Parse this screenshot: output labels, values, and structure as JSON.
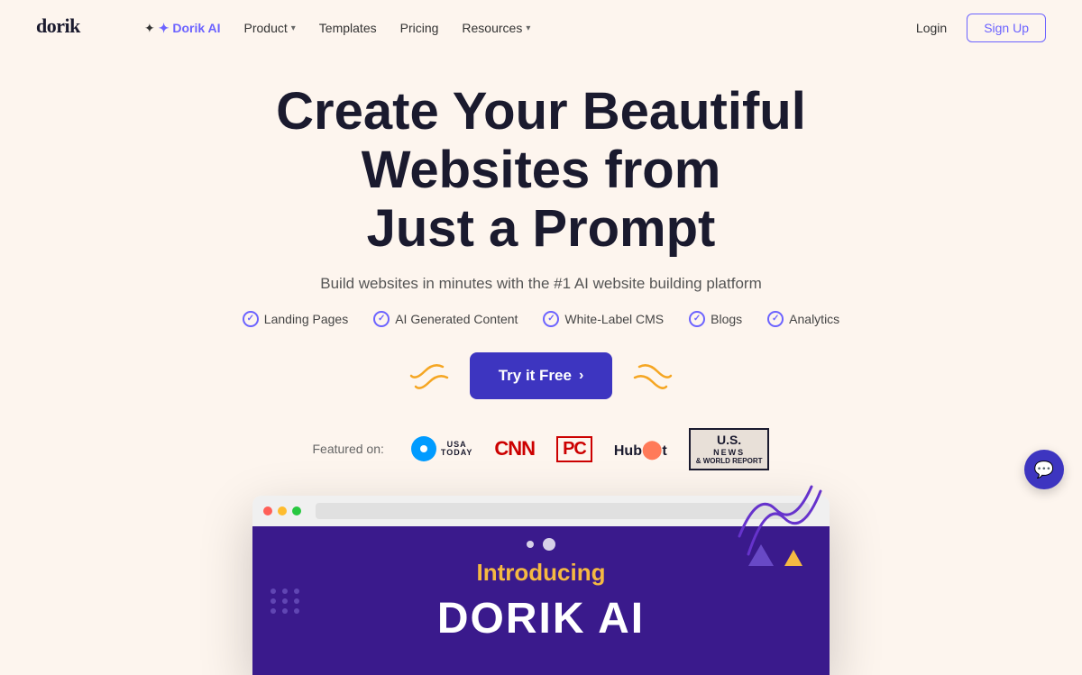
{
  "brand": {
    "logo": "dorik",
    "logo_display": "dorik"
  },
  "nav": {
    "ai_label": "✦ Dorik AI",
    "product_label": "Product",
    "templates_label": "Templates",
    "pricing_label": "Pricing",
    "resources_label": "Resources",
    "login_label": "Login",
    "signup_label": "Sign Up"
  },
  "hero": {
    "title_line1": "Create Your Beautiful Websites from",
    "title_line2": "Just a Prompt",
    "subtitle": "Build websites in minutes with the #1 AI website building platform",
    "features": [
      {
        "label": "Landing Pages"
      },
      {
        "label": "AI Generated Content"
      },
      {
        "label": "White-Label CMS"
      },
      {
        "label": "Blogs"
      },
      {
        "label": "Analytics"
      }
    ],
    "cta_label": "Try it Free",
    "cta_arrow": "›"
  },
  "featured": {
    "label": "Featured on:",
    "logos": [
      {
        "name": "USA Today"
      },
      {
        "name": "CNN"
      },
      {
        "name": "PC"
      },
      {
        "name": "HubSpot"
      },
      {
        "name": "US News"
      }
    ]
  },
  "preview": {
    "introducing": "Introducing",
    "product_name": "DORIK AI"
  },
  "colors": {
    "accent": "#3d35c0",
    "background": "#fdf5ee",
    "browser_bg": "#3a1a8c",
    "gold": "#f5b942"
  }
}
